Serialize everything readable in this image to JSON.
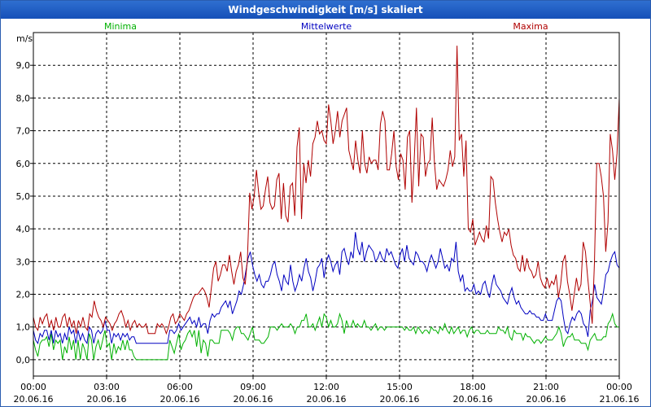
{
  "window": {
    "title": "Windgeschwindigkeit [m/s] skaliert"
  },
  "chart_data": {
    "type": "line",
    "title": "Windgeschwindigkeit [m/s] skaliert",
    "ylabel": "m/s",
    "xlabel": "",
    "ylim": [
      -0.5,
      10.0
    ],
    "y_ticks": [
      0,
      1,
      2,
      3,
      4,
      5,
      6,
      7,
      8,
      9
    ],
    "y_tick_labels": [
      "0,0",
      "1,0",
      "2,0",
      "3,0",
      "4,0",
      "5,0",
      "6,0",
      "7,0",
      "8,0",
      "9,0"
    ],
    "xlim": [
      "20.06.16 00:00",
      "21.06.16 00:00"
    ],
    "x_ticks": [
      {
        "time": "00:00",
        "date": "20.06.16"
      },
      {
        "time": "03:00",
        "date": "20.06.16"
      },
      {
        "time": "06:00",
        "date": "20.06.16"
      },
      {
        "time": "09:00",
        "date": "20.06.16"
      },
      {
        "time": "12:00",
        "date": "20.06.16"
      },
      {
        "time": "15:00",
        "date": "20.06.16"
      },
      {
        "time": "18:00",
        "date": "20.06.16"
      },
      {
        "time": "21:00",
        "date": "20.06.16"
      },
      {
        "time": "00:00",
        "date": "21.06.16"
      }
    ],
    "grid": true,
    "legend_position": "top",
    "series": [
      {
        "name": "Minima",
        "color": "#00b000",
        "values": [
          0.6,
          0.3,
          0.1,
          0.5,
          0.6,
          0.6,
          0.7,
          0.4,
          0.8,
          0.3,
          0.6,
          0.5,
          0.6,
          0.0,
          0.4,
          0.2,
          0.7,
          0.3,
          0.6,
          0.0,
          0.6,
          0.0,
          0.5,
          0.3,
          0.0,
          0.8,
          0.6,
          0.0,
          0.4,
          0.6,
          0.3,
          0.6,
          0.9,
          0.4,
          0.5,
          0.0,
          0.5,
          0.2,
          0.4,
          0.3,
          0.6,
          0.3,
          0.6,
          0.3,
          0.3,
          0.1,
          0.0,
          0.0,
          0.0,
          0.0,
          0.0,
          0.0,
          0.0,
          0.0,
          0.0,
          0.0,
          0.0,
          0.0,
          0.0,
          0.0,
          0.0,
          0.6,
          0.4,
          0.2,
          0.5,
          0.8,
          0.3,
          0.5,
          0.6,
          0.8,
          0.9,
          0.7,
          0.9,
          0.4,
          0.9,
          0.2,
          0.6,
          0.5,
          0.1,
          0.6,
          0.6,
          0.5,
          0.5,
          0.5,
          0.9,
          0.9,
          0.9,
          0.9,
          0.8,
          0.6,
          0.9,
          1.0,
          1.0,
          0.8,
          0.8,
          0.7,
          0.6,
          0.8,
          1.0,
          0.6,
          0.6,
          0.6,
          0.5,
          0.5,
          0.6,
          0.7,
          1.0,
          1.0,
          1.0,
          0.9,
          1.0,
          1.1,
          1.0,
          1.0,
          1.0,
          1.1,
          1.0,
          0.8,
          1.0,
          1.0,
          1.2,
          1.2,
          1.4,
          1.0,
          1.0,
          1.1,
          0.9,
          1.1,
          1.3,
          1.0,
          1.4,
          1.3,
          1.0,
          1.2,
          1.0,
          1.0,
          1.1,
          1.4,
          1.2,
          0.8,
          1.2,
          1.0,
          1.0,
          1.2,
          1.0,
          1.1,
          1.0,
          1.0,
          1.2,
          1.0,
          1.0,
          0.9,
          1.0,
          1.1,
          0.9,
          1.0,
          1.0,
          0.9,
          1.0,
          1.0,
          1.0,
          1.0,
          1.0,
          1.0,
          1.0,
          1.0,
          0.9,
          1.0,
          0.9,
          0.9,
          1.0,
          0.8,
          1.0,
          0.9,
          0.8,
          0.9,
          0.9,
          0.8,
          1.0,
          0.9,
          0.9,
          0.8,
          1.0,
          0.9,
          1.1,
          0.9,
          0.8,
          1.0,
          0.8,
          0.9,
          1.0,
          0.8,
          0.9,
          0.9,
          0.7,
          0.9,
          1.0,
          0.8,
          0.9,
          0.9,
          0.8,
          0.8,
          0.8,
          0.9,
          0.8,
          0.8,
          0.8,
          0.8,
          1.0,
          0.9,
          0.9,
          0.8,
          1.0,
          0.7,
          0.6,
          0.9,
          0.8,
          0.8,
          0.8,
          0.6,
          0.8,
          0.7,
          0.7,
          0.6,
          0.5,
          0.6,
          0.6,
          0.5,
          0.6,
          0.7,
          0.6,
          0.6,
          0.6,
          0.7,
          0.8,
          1.0,
          0.8,
          0.4,
          0.6,
          0.7,
          0.7,
          0.8,
          0.6,
          0.6,
          0.6,
          0.5,
          0.5,
          0.5,
          0.3,
          0.6,
          0.7,
          0.8,
          0.6,
          0.6,
          0.6,
          0.7,
          0.7,
          1.1,
          1.2,
          1.4,
          1.1,
          1.0,
          1.0
        ]
      },
      {
        "name": "Mittelwerte",
        "color": "#0000c0",
        "values": [
          0.9,
          0.6,
          0.5,
          0.8,
          0.7,
          0.9,
          0.9,
          0.6,
          0.9,
          0.5,
          0.9,
          0.7,
          0.8,
          0.5,
          0.8,
          0.6,
          1.0,
          0.8,
          0.9,
          0.5,
          0.9,
          0.6,
          0.8,
          0.6,
          0.5,
          1.0,
          0.9,
          0.5,
          0.8,
          0.9,
          0.8,
          0.9,
          1.2,
          0.9,
          0.9,
          0.5,
          0.8,
          0.7,
          0.8,
          0.6,
          0.8,
          0.7,
          0.8,
          0.6,
          0.7,
          0.7,
          0.5,
          0.5,
          0.5,
          0.5,
          0.5,
          0.5,
          0.5,
          0.5,
          0.5,
          0.5,
          0.5,
          0.5,
          0.5,
          0.5,
          0.5,
          0.9,
          0.9,
          0.8,
          0.9,
          1.1,
          0.9,
          1.0,
          1.1,
          1.2,
          1.3,
          1.1,
          1.2,
          1.0,
          1.3,
          1.0,
          1.1,
          1.1,
          0.8,
          1.2,
          1.4,
          1.3,
          1.4,
          1.4,
          1.6,
          1.7,
          1.8,
          1.6,
          1.8,
          1.4,
          1.6,
          1.8,
          2.1,
          2.0,
          2.3,
          2.7,
          3.1,
          3.3,
          2.9,
          2.6,
          2.4,
          2.6,
          2.3,
          2.2,
          2.4,
          2.4,
          2.6,
          2.9,
          3.0,
          2.6,
          2.4,
          2.1,
          2.6,
          2.4,
          2.3,
          2.9,
          2.4,
          2.1,
          2.3,
          2.6,
          2.4,
          2.8,
          3.1,
          2.7,
          2.5,
          2.1,
          2.4,
          2.8,
          2.9,
          3.1,
          2.5,
          3.0,
          3.2,
          3.0,
          2.7,
          2.9,
          3.0,
          2.6,
          3.3,
          3.4,
          3.1,
          2.9,
          3.3,
          3.1,
          3.9,
          3.4,
          3.2,
          3.6,
          3.0,
          3.3,
          3.5,
          3.4,
          3.3,
          3.0,
          3.1,
          3.3,
          3.1,
          3.0,
          3.4,
          3.2,
          3.3,
          3.1,
          2.9,
          2.8,
          3.2,
          3.4,
          3.0,
          3.5,
          3.1,
          3.0,
          2.9,
          3.3,
          3.2,
          3.0,
          3.0,
          2.9,
          2.7,
          3.0,
          3.2,
          3.0,
          2.8,
          3.0,
          3.4,
          3.1,
          2.8,
          2.9,
          2.7,
          3.1,
          3.0,
          3.6,
          2.7,
          2.4,
          2.6,
          2.1,
          2.2,
          2.1,
          2.1,
          2.3,
          2.0,
          2.1,
          2.0,
          2.3,
          2.4,
          2.1,
          1.9,
          2.3,
          2.6,
          2.3,
          2.2,
          2.1,
          1.9,
          1.8,
          1.7,
          2.0,
          2.2,
          1.9,
          1.7,
          1.8,
          1.6,
          1.5,
          1.4,
          1.4,
          1.5,
          1.4,
          1.4,
          1.3,
          1.3,
          1.2,
          1.2,
          1.4,
          1.2,
          1.2,
          1.2,
          1.5,
          1.8,
          1.9,
          1.8,
          1.3,
          0.9,
          0.8,
          1.1,
          1.3,
          1.2,
          1.4,
          1.5,
          1.4,
          1.1,
          1.0,
          0.7,
          1.5,
          1.8,
          2.3,
          1.9,
          1.8,
          1.7,
          2.1,
          2.6,
          2.7,
          3.0,
          3.2,
          3.3,
          2.9,
          2.8
        ]
      },
      {
        "name": "Maxima",
        "color": "#b00000",
        "values": [
          1.3,
          1.0,
          0.9,
          1.3,
          1.1,
          1.3,
          1.4,
          1.0,
          1.2,
          0.9,
          1.3,
          1.0,
          1.0,
          1.3,
          1.4,
          1.0,
          1.3,
          1.0,
          1.2,
          0.8,
          1.2,
          1.0,
          1.3,
          1.0,
          0.9,
          1.4,
          1.3,
          1.8,
          1.5,
          1.3,
          1.2,
          1.0,
          1.3,
          1.2,
          1.1,
          0.9,
          1.1,
          1.2,
          1.4,
          1.5,
          1.3,
          1.0,
          1.2,
          0.9,
          1.1,
          1.2,
          1.0,
          1.1,
          1.0,
          1.0,
          1.1,
          0.8,
          0.8,
          0.8,
          0.8,
          1.1,
          1.0,
          1.1,
          1.0,
          0.8,
          1.0,
          1.3,
          1.4,
          1.1,
          1.2,
          1.4,
          1.3,
          1.2,
          1.4,
          1.5,
          1.7,
          1.9,
          2.0,
          2.0,
          2.1,
          2.2,
          2.1,
          1.9,
          1.6,
          2.2,
          2.8,
          3.0,
          2.4,
          2.6,
          2.9,
          2.9,
          2.7,
          3.2,
          2.7,
          2.3,
          2.7,
          2.9,
          3.3,
          2.5,
          2.3,
          3.1,
          5.1,
          4.6,
          5.0,
          5.8,
          5.1,
          4.6,
          4.7,
          5.2,
          5.6,
          4.8,
          4.6,
          4.7,
          5.5,
          5.7,
          4.3,
          5.4,
          4.4,
          4.2,
          5.3,
          5.4,
          4.4,
          6.5,
          7.1,
          4.3,
          6.0,
          5.4,
          6.1,
          5.6,
          6.6,
          6.8,
          7.3,
          6.9,
          7.0,
          6.7,
          6.6,
          7.8,
          7.3,
          6.6,
          7.0,
          7.6,
          6.8,
          7.3,
          7.5,
          7.7,
          6.4,
          6.1,
          5.8,
          6.7,
          6.1,
          5.7,
          7.0,
          6.0,
          5.7,
          6.2,
          6.0,
          6.1,
          6.1,
          5.8,
          7.2,
          7.6,
          7.3,
          5.8,
          5.8,
          6.3,
          7.0,
          5.9,
          5.5,
          6.3,
          6.1,
          5.2,
          6.8,
          7.0,
          4.8,
          6.1,
          7.7,
          5.3,
          6.9,
          6.8,
          5.6,
          6.0,
          6.1,
          7.4,
          6.0,
          5.2,
          5.5,
          5.4,
          5.3,
          5.5,
          5.8,
          6.4,
          5.9,
          6.2,
          9.6,
          6.7,
          6.9,
          5.6,
          6.7,
          4.0,
          3.9,
          4.3,
          3.5,
          3.7,
          3.9,
          3.7,
          3.6,
          4.1,
          3.7,
          5.6,
          5.5,
          4.8,
          4.3,
          3.9,
          3.6,
          3.9,
          3.8,
          4.0,
          3.5,
          3.2,
          3.1,
          2.8,
          2.7,
          3.2,
          2.7,
          3.1,
          2.8,
          2.7,
          2.5,
          2.6,
          3.0,
          2.5,
          2.3,
          2.2,
          2.5,
          2.2,
          2.4,
          2.3,
          2.6,
          1.9,
          2.3,
          3.0,
          3.2,
          2.4,
          2.0,
          1.5,
          2.0,
          2.5,
          2.1,
          2.3,
          3.6,
          3.3,
          2.5,
          1.8,
          1.1,
          3.0,
          6.0,
          6.0,
          5.6,
          5.0,
          3.3,
          4.2,
          6.9,
          6.4,
          5.5,
          6.3,
          8.0
        ]
      }
    ]
  }
}
